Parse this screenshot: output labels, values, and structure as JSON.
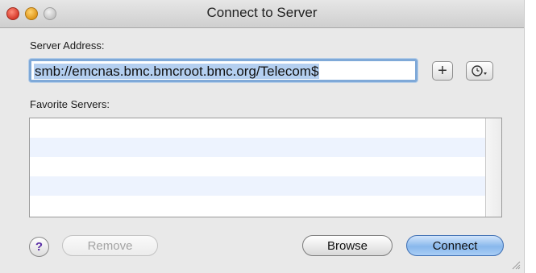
{
  "window": {
    "title": "Connect to Server"
  },
  "server_address": {
    "label": "Server Address:",
    "value": "smb://emcnas.bmc.bmcroot.bmc.org/Telecom$"
  },
  "buttons": {
    "add_favorite": "+",
    "remove": "Remove",
    "browse": "Browse",
    "connect": "Connect",
    "help": "?"
  },
  "favorites": {
    "label": "Favorite Servers:",
    "items": []
  },
  "icons": {
    "recent": "clock-icon",
    "add": "plus-icon"
  },
  "colors": {
    "accent": "#7fa9d8",
    "connect_button": "#88b7ec",
    "stripe": "#edf3fe"
  }
}
